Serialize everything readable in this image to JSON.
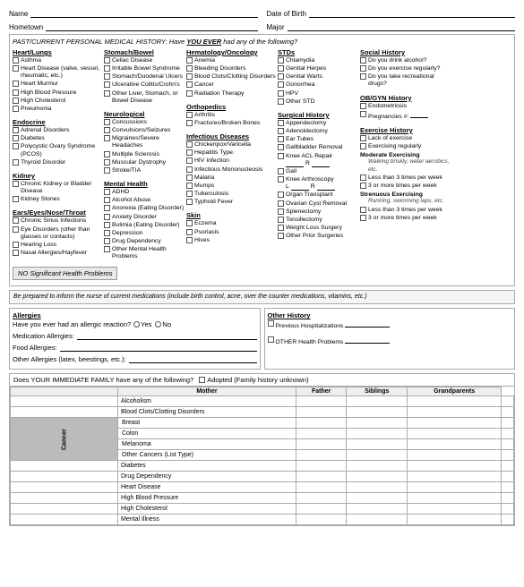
{
  "header": {
    "name_label": "Name",
    "dob_label": "Date of Birth",
    "hometown_label": "Hometown",
    "major_label": "Major"
  },
  "past_history": {
    "label": "PAST/CURRENT PERSONAL MEDICAL HISTORY: Have",
    "label_you": "YOU EVER",
    "label_rest": "had any of the following?",
    "columns": {
      "col1": {
        "heart_lungs": {
          "title": "Heart/Lungs",
          "items": [
            "Asthma",
            "Heart Disease (valve, vessel, rheumatic, etc.)",
            "Heart Murmur",
            "High Blood Pressure",
            "High Cholesterol",
            "Pneumonia"
          ]
        },
        "endocrine": {
          "title": "Endocrine",
          "items": [
            "Adrenal Disorders",
            "Diabetes",
            "Polycystic Ovary Syndrome (PCOS)",
            "Thyroid Disorder"
          ]
        },
        "kidney": {
          "title": "Kidney",
          "items": [
            "Chronic Kidney or Bladder Disease",
            "Kidney Stones"
          ]
        },
        "ears": {
          "title": "Ears/Eyes/Nose/Throat",
          "items": [
            "Chronic Sinus Infections",
            "Eye Disorders (other than glasses or contacts)",
            "Hearing Loss",
            "Nasal Allergies/Hayfever"
          ]
        }
      },
      "col2": {
        "stomach": {
          "title": "Stomach/Bowel",
          "items": [
            "Celiac Disease",
            "Irritable Bowel Syndrome",
            "Stomach/Duodenal Ulcers",
            "Ulcerative Colitis/Crohn's",
            "Other Liver, Stomach, or Bowel Disease"
          ]
        },
        "neuro": {
          "title": "Neurological",
          "items": [
            "Concussions",
            "Convulsions/Seizures",
            "Migraines/Severe Headaches",
            "Multiple Sclerosis",
            "Muscular Dystrophy",
            "Stroke/TIA"
          ]
        },
        "mental": {
          "title": "Mental Health",
          "items": [
            "ADHD",
            "Alcohol Abuse",
            "Anorexia (Eating Disorder)",
            "Anxiety Disorder",
            "Bulimia (Eating Disorder)",
            "Depression",
            "Drug Dependency",
            "Other Mental Health Problems"
          ]
        }
      },
      "col3": {
        "hematology": {
          "title": "Hematology/Oncology",
          "items": [
            "Anemia",
            "Bleeding Disorders",
            "Blood Clots/Clotting Disorders",
            "Cancer",
            "Radiation Therapy"
          ]
        },
        "orthopedics": {
          "title": "Orthopedics",
          "items": [
            "Arthritis",
            "Fractures/Broken Bones"
          ]
        },
        "infectious": {
          "title": "Infectious Diseases",
          "items": [
            "Chickenpox/Varicella",
            "Hepatitis Type:",
            "HIV Infection",
            "Infectious Mononucleosis",
            "Malaria",
            "Mumps",
            "Tuberculosis",
            "Typhoid Fever"
          ]
        },
        "skin": {
          "title": "Skin",
          "items": [
            "Eczema",
            "Psoriasis",
            "Hives"
          ]
        }
      },
      "col4": {
        "stds": {
          "title": "STDs",
          "items": [
            "Chlamydia",
            "Genital Herpes",
            "Genital Warts",
            "Gonorrhea",
            "HPV",
            "Other STD"
          ]
        },
        "surgical": {
          "title": "Surgical History",
          "items": [
            "Appendectomy",
            "Adenoidectomy",
            "Ear Tubes",
            "Gallbladder Removal",
            "Knee ACL Repair",
            "Knee Arthroscopy",
            "Organ Transplant",
            "Ovarian Cyst Removal",
            "Splenectomy",
            "Tonsillectomy",
            "Weight Loss Surgery",
            "Other Prior Surgeries"
          ]
        }
      },
      "col5": {
        "social": {
          "title": "Social History",
          "items": [
            "Do you drink alcohol?",
            "Do you exercise regularly?",
            "Do you take recreational drugs?"
          ]
        },
        "obgyn": {
          "title": "OB/GYN History",
          "items": [
            "Endometriosis",
            "Pregnancies #:"
          ]
        },
        "exercise": {
          "title": "Exercise History",
          "items": [
            "Lack of exercise",
            "Exercising regularly"
          ],
          "moderate_label": "Moderate Exercising",
          "moderate_note": "Walking briskly, water aerobics, etc.",
          "mod_items": [
            "Less than 3 times per week",
            "3 or more times per week"
          ],
          "strenuous_label": "Strenuous Exercising",
          "strenuous_note": "Running, swimming laps, etc.",
          "str_items": [
            "Less than 3 times per week",
            "3 or more times per week"
          ]
        }
      }
    },
    "no_sig_label": "NO Significant Health Problems"
  },
  "nurse_note": "Be prepared to inform the nurse of current medications (include birth control, acne, over the counter medications, vitamins, etc.)",
  "allergies": {
    "title": "Allergies",
    "reaction_label": "Have you ever had an allergic reaction?",
    "yes": "Yes",
    "no": "No",
    "med_label": "Medication Allergies:",
    "food_label": "Food Allergies:",
    "other_label": "Other Allergies (latex, beestings, etc.):"
  },
  "other_history": {
    "title": "Other History",
    "items": [
      "Previous Hospitalizations",
      "OTHER Health Problems"
    ]
  },
  "family_history": {
    "header": "Does YOUR IMMEDIATE FAMILY have any of the following?",
    "adopted_label": "Adopted (Family history unknown)",
    "columns": [
      "Mother",
      "Father",
      "Siblings",
      "Grandparents"
    ],
    "rows": [
      {
        "label": "Alcoholism",
        "cancer": false
      },
      {
        "label": "Blood Clots/Clotting Disorders",
        "cancer": false
      },
      {
        "label": "Breast",
        "cancer": true
      },
      {
        "label": "Colon",
        "cancer": true
      },
      {
        "label": "Melanoma",
        "cancer": true
      },
      {
        "label": "Other Cancers (List Type)",
        "cancer": true
      },
      {
        "label": "Diabetes",
        "cancer": false
      },
      {
        "label": "Drug Dependency",
        "cancer": false
      },
      {
        "label": "Heart Disease",
        "cancer": false
      },
      {
        "label": "High Blood Pressure",
        "cancer": false
      },
      {
        "label": "High Cholesterol",
        "cancer": false
      },
      {
        "label": "Mental Illness",
        "cancer": false
      }
    ],
    "cancer_label": "Cancer"
  }
}
